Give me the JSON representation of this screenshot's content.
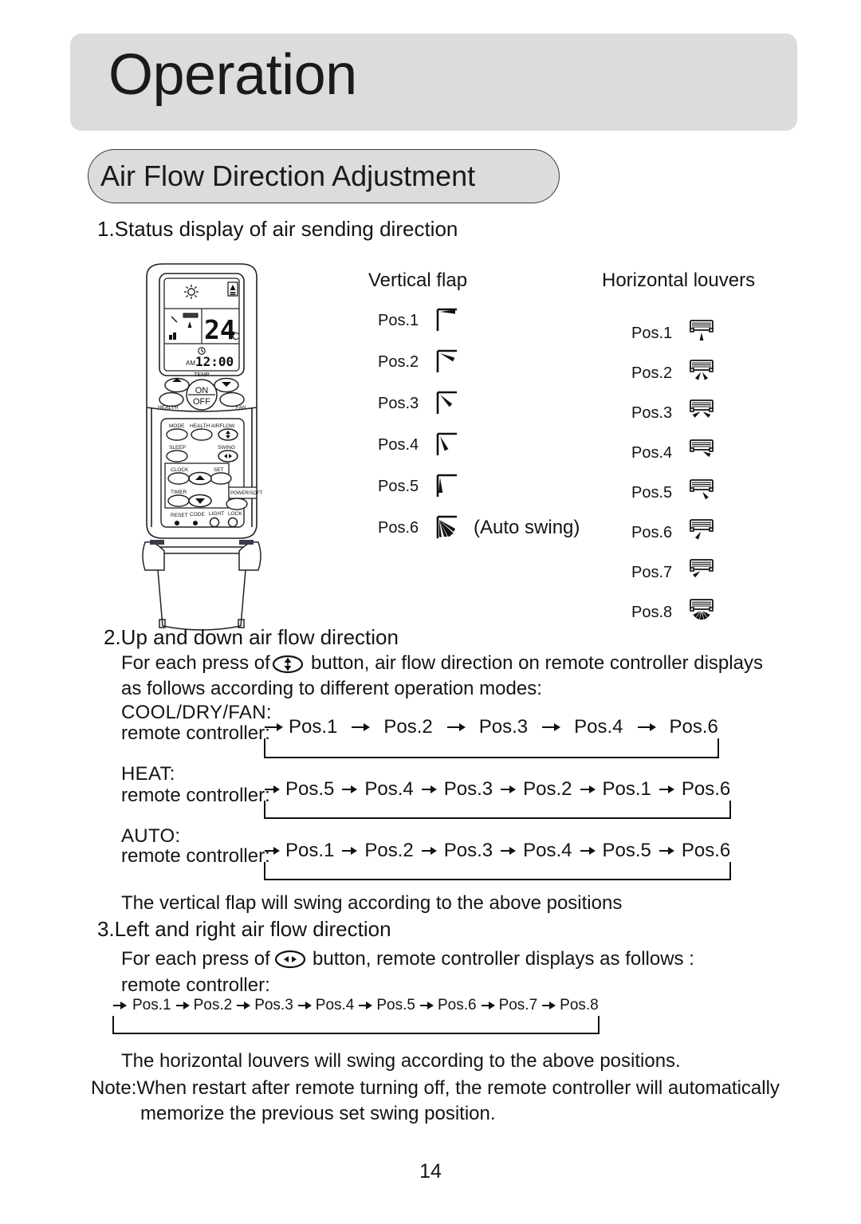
{
  "header": {
    "title": "Operation",
    "section_title": "Air Flow Direction Adjustment"
  },
  "sections": {
    "s1_heading": "1.Status display of air sending direction",
    "s2_heading": "2.Up and down air flow direction",
    "s2_line1_a": "For each press of",
    "s2_line1_b": "button, air flow direction on remote controller displays",
    "s2_line2": "as follows according to different operation modes:",
    "s2_footer": "The vertical flap will swing according to the above positions",
    "s3_heading": "3.Left and right air flow direction",
    "s3_line1_a": "For each press of",
    "s3_line1_b": "button, remote controller displays as follows :",
    "s3_line2": "remote controller:",
    "s3_footer": "The horizontal louvers will swing according to the above positions.",
    "note_line1": "Note:When restart after remote turning off, the remote controller will automatically",
    "note_line2": "memorize the previous set swing position."
  },
  "columns": {
    "vertical_flap_title": "Vertical flap",
    "horizontal_louvers_title": "Horizontal louvers",
    "vertical_flap_positions": [
      {
        "label": "Pos.1",
        "angle": 0,
        "note": ""
      },
      {
        "label": "Pos.2",
        "angle": 25,
        "note": ""
      },
      {
        "label": "Pos.3",
        "angle": 45,
        "note": ""
      },
      {
        "label": "Pos.4",
        "angle": 65,
        "note": ""
      },
      {
        "label": "Pos.5",
        "angle": 88,
        "note": ""
      },
      {
        "label": "Pos.6",
        "angle": 0,
        "note": "(Auto swing)"
      }
    ],
    "horizontal_louver_positions": [
      {
        "label": "Pos.1",
        "type": "single",
        "angles": [
          0
        ]
      },
      {
        "label": "Pos.2",
        "type": "double",
        "angles": [
          -30,
          30
        ]
      },
      {
        "label": "Pos.3",
        "type": "double",
        "angles": [
          -55,
          55
        ]
      },
      {
        "label": "Pos.4",
        "type": "single",
        "angles": [
          -60
        ]
      },
      {
        "label": "Pos.5",
        "type": "single",
        "angles": [
          -35
        ]
      },
      {
        "label": "Pos.6",
        "type": "single",
        "angles": [
          30
        ]
      },
      {
        "label": "Pos.7",
        "type": "single",
        "angles": [
          52
        ]
      },
      {
        "label": "Pos.8",
        "type": "fan",
        "angles": [
          -50,
          -25,
          0,
          25,
          50
        ]
      }
    ]
  },
  "flows": {
    "cool_dry_fan": {
      "mode_label": "COOL/DRY/FAN:",
      "prefix": "remote controller:",
      "steps": [
        "Pos.1",
        "Pos.2",
        "Pos.3",
        "Pos.4",
        "Pos.6"
      ]
    },
    "heat": {
      "mode_label": "HEAT:",
      "prefix": "remote controller:",
      "steps": [
        "Pos.5",
        "Pos.4",
        "Pos.3",
        "Pos.2",
        "Pos.1",
        "Pos.6"
      ]
    },
    "auto": {
      "mode_label": "AUTO:",
      "prefix": "remote controller:",
      "steps": [
        "Pos.1",
        "Pos.2",
        "Pos.3",
        "Pos.4",
        "Pos.5",
        "Pos.6"
      ]
    },
    "left_right": {
      "steps": [
        "Pos.1",
        "Pos.2",
        "Pos.3",
        "Pos.4",
        "Pos.5",
        "Pos.6",
        "Pos.7",
        "Pos.8"
      ]
    }
  },
  "remote": {
    "display": {
      "temperature": "24",
      "unit": "C",
      "clock_meridiem": "AM",
      "clock_time": "12:00"
    },
    "buttons": {
      "temp": "TEMP",
      "on": "ON",
      "off": "OFF",
      "health": "HEALTH",
      "fan": "FAN",
      "mode": "MODE",
      "health_airflow": "HEALTH AIRFLOW",
      "sleep": "SLEEP",
      "swing": "SWING",
      "clock": "CLOCK",
      "set": "SET",
      "timer": "TIMER",
      "powersoft": "POWER/SOFT",
      "reset": "RESET",
      "code": "CODE",
      "light": "LIGHT",
      "lock": "LOCK"
    }
  },
  "page_number": "14",
  "colors": {
    "band_gray": "#dcdcdd",
    "ink": "#141414"
  }
}
